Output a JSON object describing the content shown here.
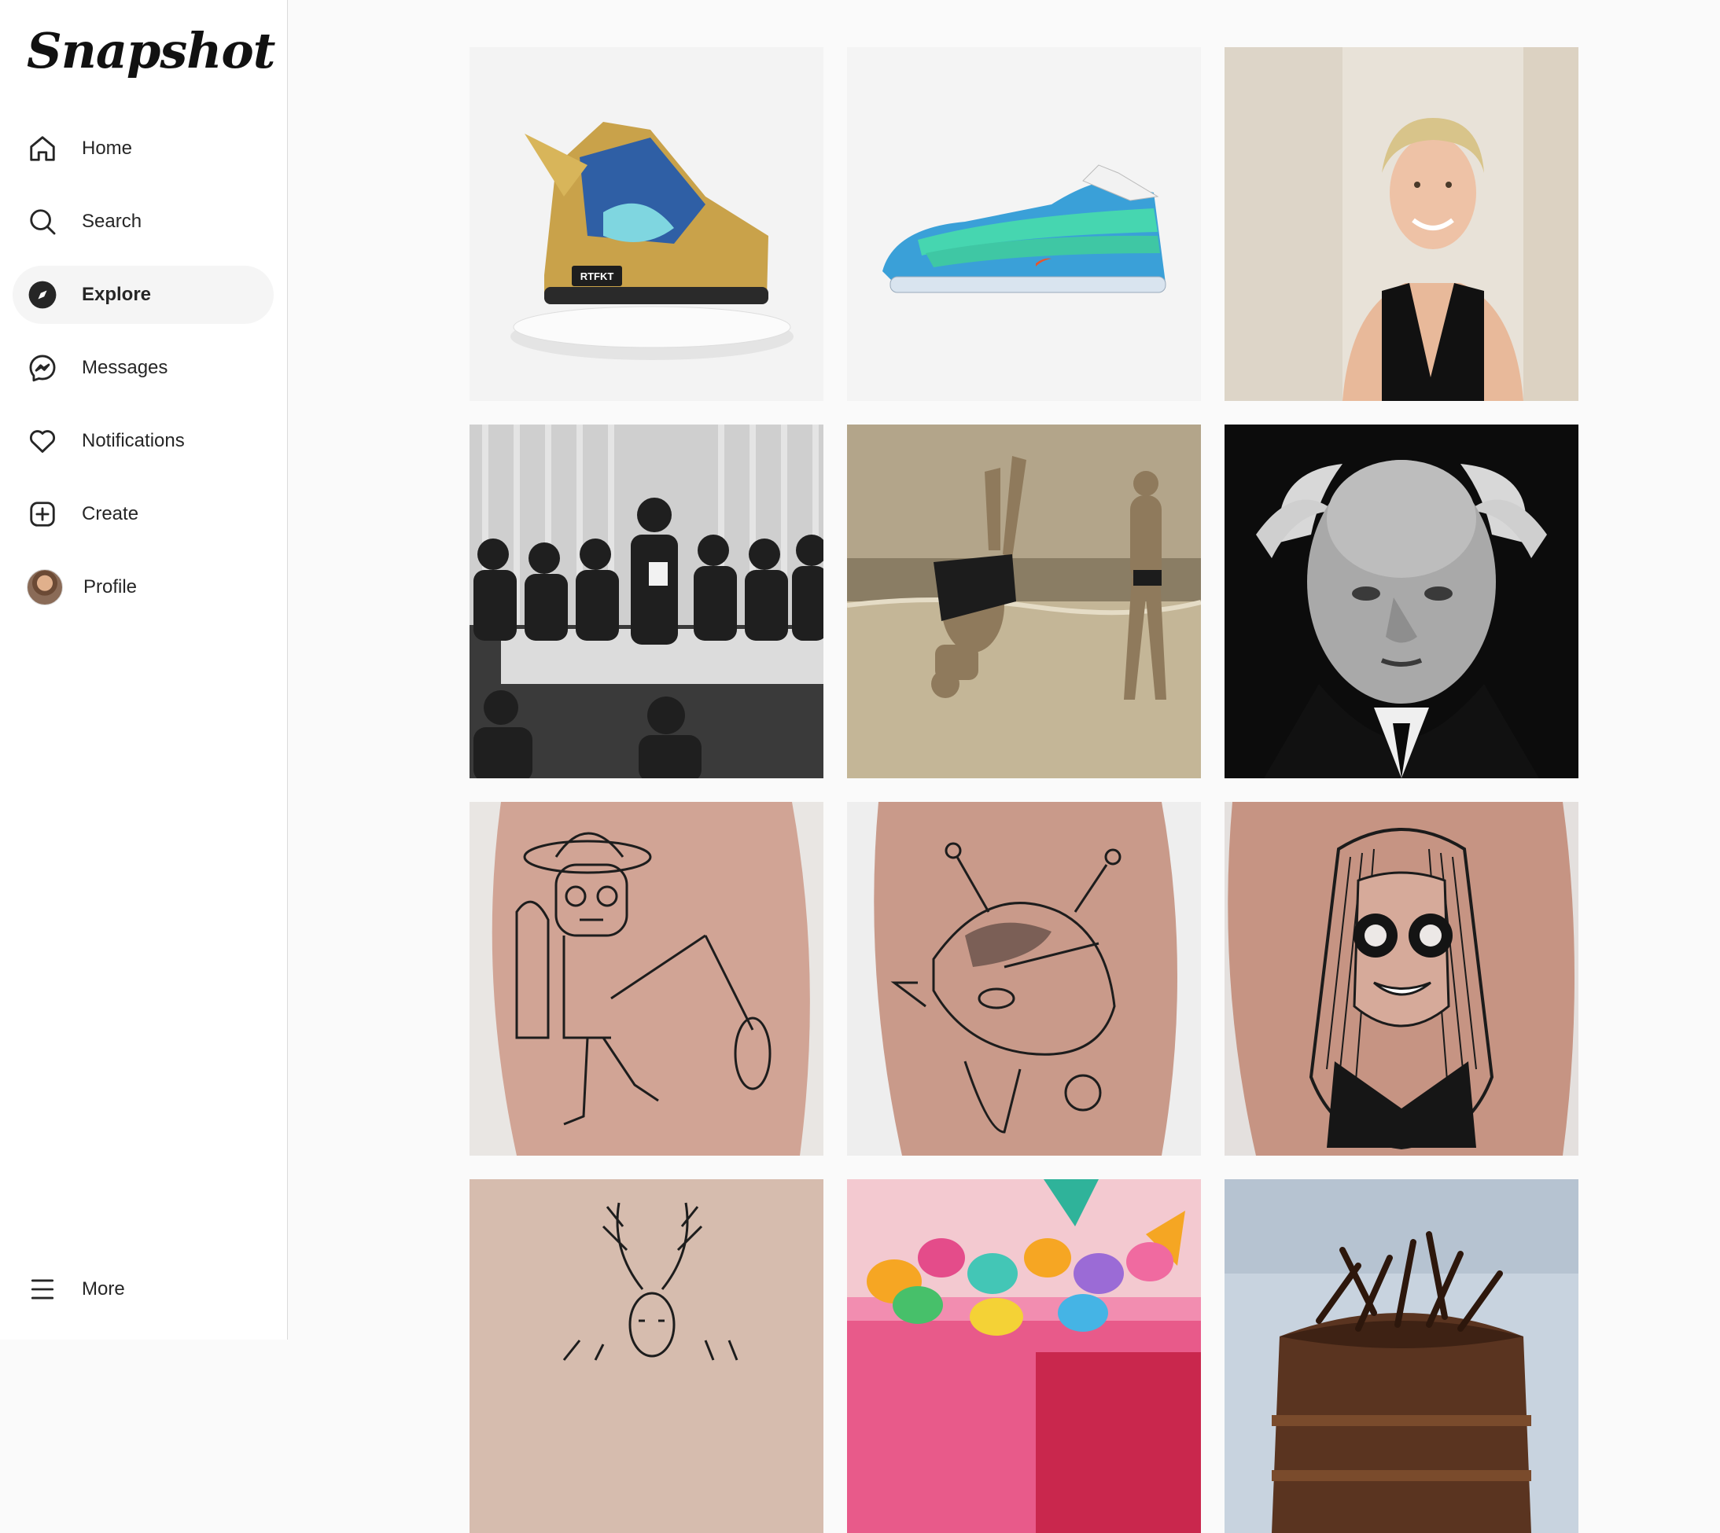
{
  "app": {
    "name": "Snapshot"
  },
  "nav": {
    "items": [
      {
        "label": "Home",
        "icon": "home-icon"
      },
      {
        "label": "Search",
        "icon": "search-icon"
      },
      {
        "label": "Explore",
        "icon": "compass-icon",
        "active": true
      },
      {
        "label": "Messages",
        "icon": "messenger-icon"
      },
      {
        "label": "Notifications",
        "icon": "heart-icon"
      },
      {
        "label": "Create",
        "icon": "plus-square-icon"
      },
      {
        "label": "Profile",
        "icon": "avatar"
      }
    ],
    "more": {
      "label": "More",
      "icon": "hamburger-icon"
    }
  },
  "grid": {
    "tiles": [
      {
        "subject": "gold-sneaker-photo"
      },
      {
        "subject": "blue-sneaker-photo"
      },
      {
        "subject": "portrait-photo"
      },
      {
        "subject": "historic-ceremony-photo"
      },
      {
        "subject": "beach-headstand-photo"
      },
      {
        "subject": "elderly-man-portrait-photo"
      },
      {
        "subject": "skeleton-fishing-tattoo-photo"
      },
      {
        "subject": "pig-tattoo-photo"
      },
      {
        "subject": "woman-glasses-tattoo-photo"
      },
      {
        "subject": "deer-antlers-tattoo-photo"
      },
      {
        "subject": "cupcake-cake-photo"
      },
      {
        "subject": "chocolate-cake-photo"
      }
    ],
    "sneaker_badge": "RTFKT"
  }
}
